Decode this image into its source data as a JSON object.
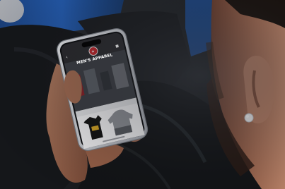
{
  "photo": {
    "description": "",
    "palette": {
      "sofa_blue": "#1e56a6",
      "jacket_black": "#17191c",
      "skin": "#a06a52",
      "phone_body": "#d8dadf",
      "screen_dark": "#2a2a2e",
      "screen_light": "#f5f5f7",
      "logo_red": "#c1272d"
    }
  },
  "phone_screen": {
    "status_time": "",
    "status_icons": "",
    "title": "MEN'S APPAREL",
    "toolbar_icons": [
      "back-arrow-icon",
      "logo-icon",
      "cart-icon"
    ],
    "products": [
      {
        "name": "",
        "price": "",
        "image": "black-tshirt-icon"
      },
      {
        "name": "",
        "price": "",
        "image": "gray-hoodie-icon"
      }
    ]
  }
}
